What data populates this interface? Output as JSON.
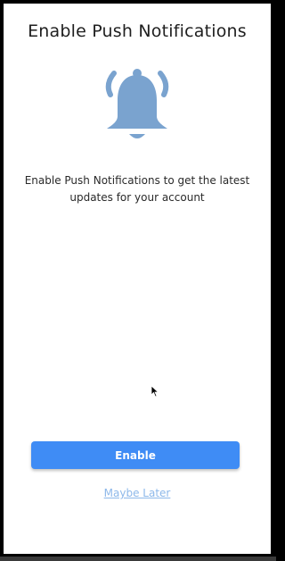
{
  "screen": {
    "title": "Enable Push Notifications",
    "icon": "bell-icon",
    "description": "Enable Push Notifications to get the latest updates for your account",
    "primary_button_label": "Enable",
    "secondary_link_label": "Maybe Later"
  },
  "colors": {
    "accent": "#3f8cf5",
    "icon": "#7aa3cf",
    "link": "#8db8ea",
    "background": "#ffffff"
  }
}
